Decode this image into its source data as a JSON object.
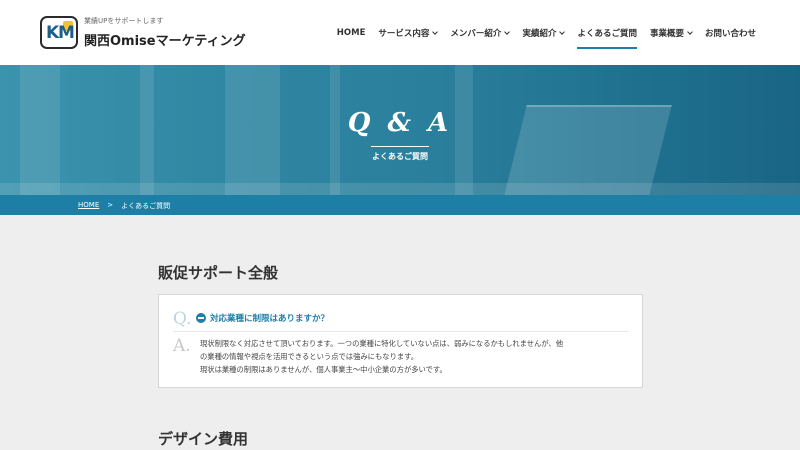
{
  "header": {
    "logo_k": "K",
    "logo_m": "M",
    "tagline": "業績UPをサポートします",
    "site_name": "関西Omiseマーケティング"
  },
  "nav": [
    {
      "label": "HOME",
      "dropdown": false,
      "active": false
    },
    {
      "label": "サービス内容",
      "dropdown": true,
      "active": false
    },
    {
      "label": "メンバー紹介",
      "dropdown": true,
      "active": false
    },
    {
      "label": "実績紹介",
      "dropdown": true,
      "active": false
    },
    {
      "label": "よくあるご質問",
      "dropdown": false,
      "active": true
    },
    {
      "label": "事業概要",
      "dropdown": true,
      "active": false
    },
    {
      "label": "お問い合わせ",
      "dropdown": false,
      "active": false
    }
  ],
  "hero": {
    "title": "Q & A",
    "subtitle": "よくあるご質問"
  },
  "breadcrumb": {
    "home": "HOME",
    "separator": ">",
    "current": "よくあるご質問"
  },
  "sections": [
    {
      "title": "販促サポート全般",
      "faq": {
        "q_letter": "Q.",
        "question": "対応業種に制限はありますか？",
        "a_letter": "A.",
        "answer_lines": [
          "現状制限なく対応させて頂いております。一つの業種に特化していない点は、弱みになるかもしれませんが、他",
          "の業種の情報や視点を活用できるという点では強みにもなります。",
          "現状は業種の制限はありませんが、個人事業主〜中小企業の方が多いです。"
        ]
      }
    },
    {
      "title": "デザイン費用"
    }
  ],
  "colors": {
    "accent": "#1e7fa6",
    "background": "#eeeeee",
    "text": "#333333"
  }
}
